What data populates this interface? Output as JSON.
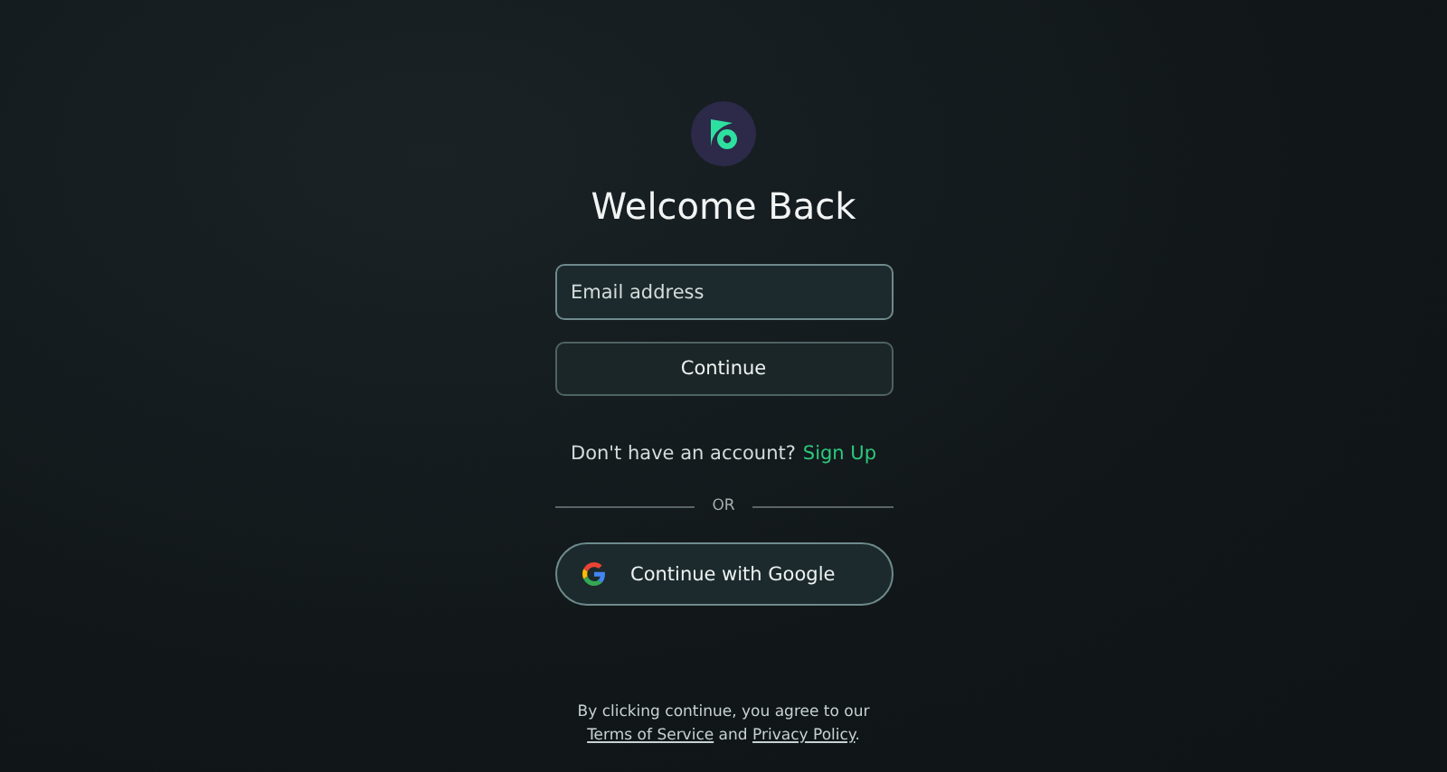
{
  "title": "Welcome Back",
  "email_field": {
    "placeholder": "Email address"
  },
  "continue_button": {
    "label": "Continue"
  },
  "signup": {
    "prompt": "Don't have an account?",
    "link": "Sign Up"
  },
  "divider": {
    "label": "OR"
  },
  "google_button": {
    "label": "Continue with Google"
  },
  "footer": {
    "before": "By clicking continue, you agree to our ",
    "terms": "Terms of Service",
    "middle": " and ",
    "privacy": "Privacy Policy",
    "after": "."
  }
}
